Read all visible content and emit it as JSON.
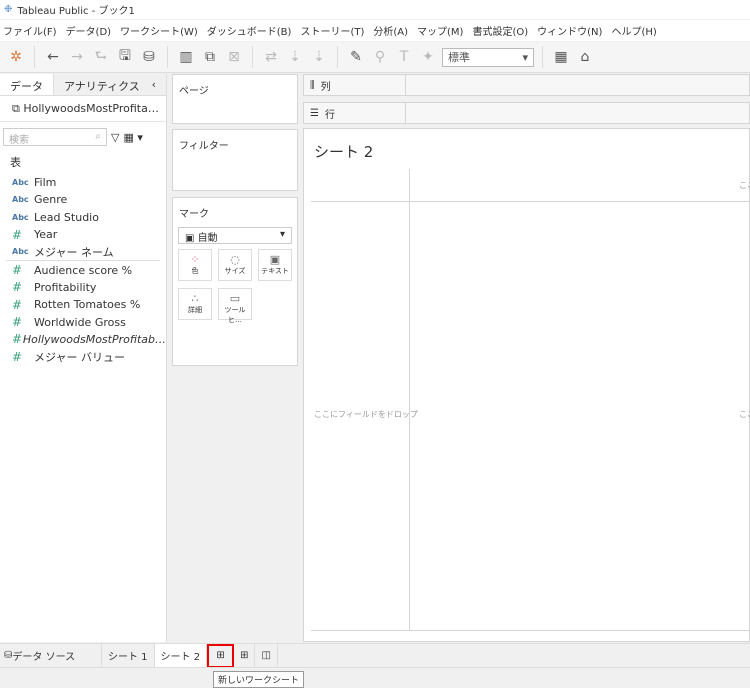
{
  "title": "Tableau Public - ブック1",
  "menu": [
    "ファイル(F)",
    "データ(D)",
    "ワークシート(W)",
    "ダッシュボード(B)",
    "ストーリー(T)",
    "分析(A)",
    "マップ(M)",
    "書式設定(O)",
    "ウィンドウ(N)",
    "ヘルプ(H)"
  ],
  "toolbar": {
    "fit_select": "標準"
  },
  "left": {
    "tab_data": "データ",
    "tab_analytics": "アナリティクス",
    "datasource": "HollywoodsMostProfita…",
    "search_placeholder": "検索",
    "table_label": "表",
    "dimensions": [
      {
        "type": "Abc",
        "name": "Film"
      },
      {
        "type": "Abc",
        "name": "Genre"
      },
      {
        "type": "Abc",
        "name": "Lead Studio"
      },
      {
        "type": "#",
        "name": "Year"
      },
      {
        "type": "Abc",
        "name": "メジャー ネーム"
      }
    ],
    "measures": [
      {
        "type": "#",
        "name": "Audience  score %"
      },
      {
        "type": "#",
        "name": "Profitability"
      },
      {
        "type": "#",
        "name": "Rotten Tomatoes %"
      },
      {
        "type": "#",
        "name": "Worldwide Gross"
      },
      {
        "type": "#",
        "name": "HollywoodsMostProfitab…"
      },
      {
        "type": "#",
        "name": "メジャー バリュー"
      }
    ]
  },
  "shelves": {
    "pages": "ページ",
    "filters": "フィルター",
    "marks": "マーク",
    "mark_type": "自動",
    "mark_buttons": [
      "色",
      "サイズ",
      "テキスト",
      "詳細",
      "ツールヒ…"
    ],
    "columns": "列",
    "rows": "行"
  },
  "sheet": {
    "title": "シート 2",
    "drop_field": "ここにフィールドをドロップ",
    "drop_cut": "ここ"
  },
  "bottom": {
    "datasource": "データ ソース",
    "tabs": [
      "シート 1",
      "シート 2"
    ],
    "tooltip": "新しいワークシート"
  }
}
